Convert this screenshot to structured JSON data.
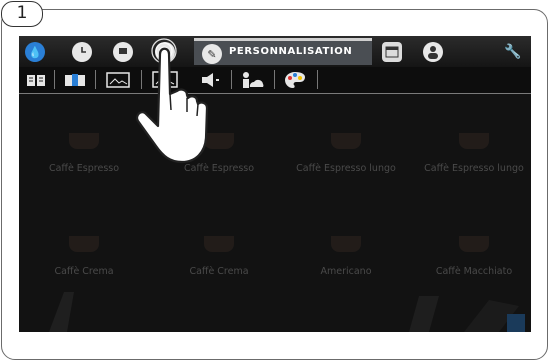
{
  "step": {
    "number": "1"
  },
  "topbar": {
    "active_tab_label": "PERSONNALISATION",
    "icons": [
      "water-drop-icon",
      "clock-icon",
      "flag-icon",
      "info-icon",
      "pencil-icon",
      "calendar-icon",
      "user-icon",
      "wrench-icon"
    ]
  },
  "subbar": {
    "icons": [
      "book-icon",
      "book-blue-icon",
      "picture-icon",
      "screen-picture-icon",
      "speaker-icon",
      "user-cloud-icon",
      "palette-icon"
    ],
    "active_index": 3
  },
  "products": [
    {
      "label": "Caffè Espresso"
    },
    {
      "label": "Caffè Espresso"
    },
    {
      "label": "Caffè Espresso lungo"
    },
    {
      "label": "Caffè Espresso lungo"
    },
    {
      "label": "Caffè Crema"
    },
    {
      "label": "Caffè Crema"
    },
    {
      "label": "Americano"
    },
    {
      "label": "Caffè Macchiato"
    }
  ],
  "colors": {
    "active_tab": "#4a4e53",
    "screen_bg": "#121212",
    "accent_blue": "#2a7fd6"
  }
}
